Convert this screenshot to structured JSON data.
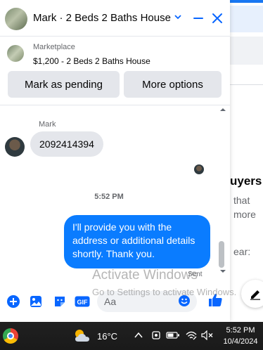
{
  "header": {
    "title": "Mark · 2 Beds 2 Baths House"
  },
  "listing": {
    "source_label": "Marketplace",
    "title": "$1,200 - 2 Beds 2 Baths House",
    "primary_action": "Mark as pending",
    "secondary_action": "More options"
  },
  "conversation": {
    "sender_name": "Mark",
    "incoming_message": "2092414394",
    "timestamp": "5:52 PM",
    "outgoing_message": "I'll provide you with the address or additional details shortly. Thank you.",
    "status": "Sent"
  },
  "composer": {
    "placeholder": "Aa"
  },
  "background_page": {
    "heading_fragment": "uyers",
    "line1": "that",
    "line2": "more",
    "line3": "ear:"
  },
  "watermark": {
    "line1": "Activate Windows",
    "line2": "Go to Settings to activate Windows."
  },
  "taskbar": {
    "temperature": "16°C",
    "time": "5:52 PM",
    "date": "10/4/2024"
  },
  "colors": {
    "accent": "#0a7cff",
    "icon_blue": "#0866ff"
  }
}
